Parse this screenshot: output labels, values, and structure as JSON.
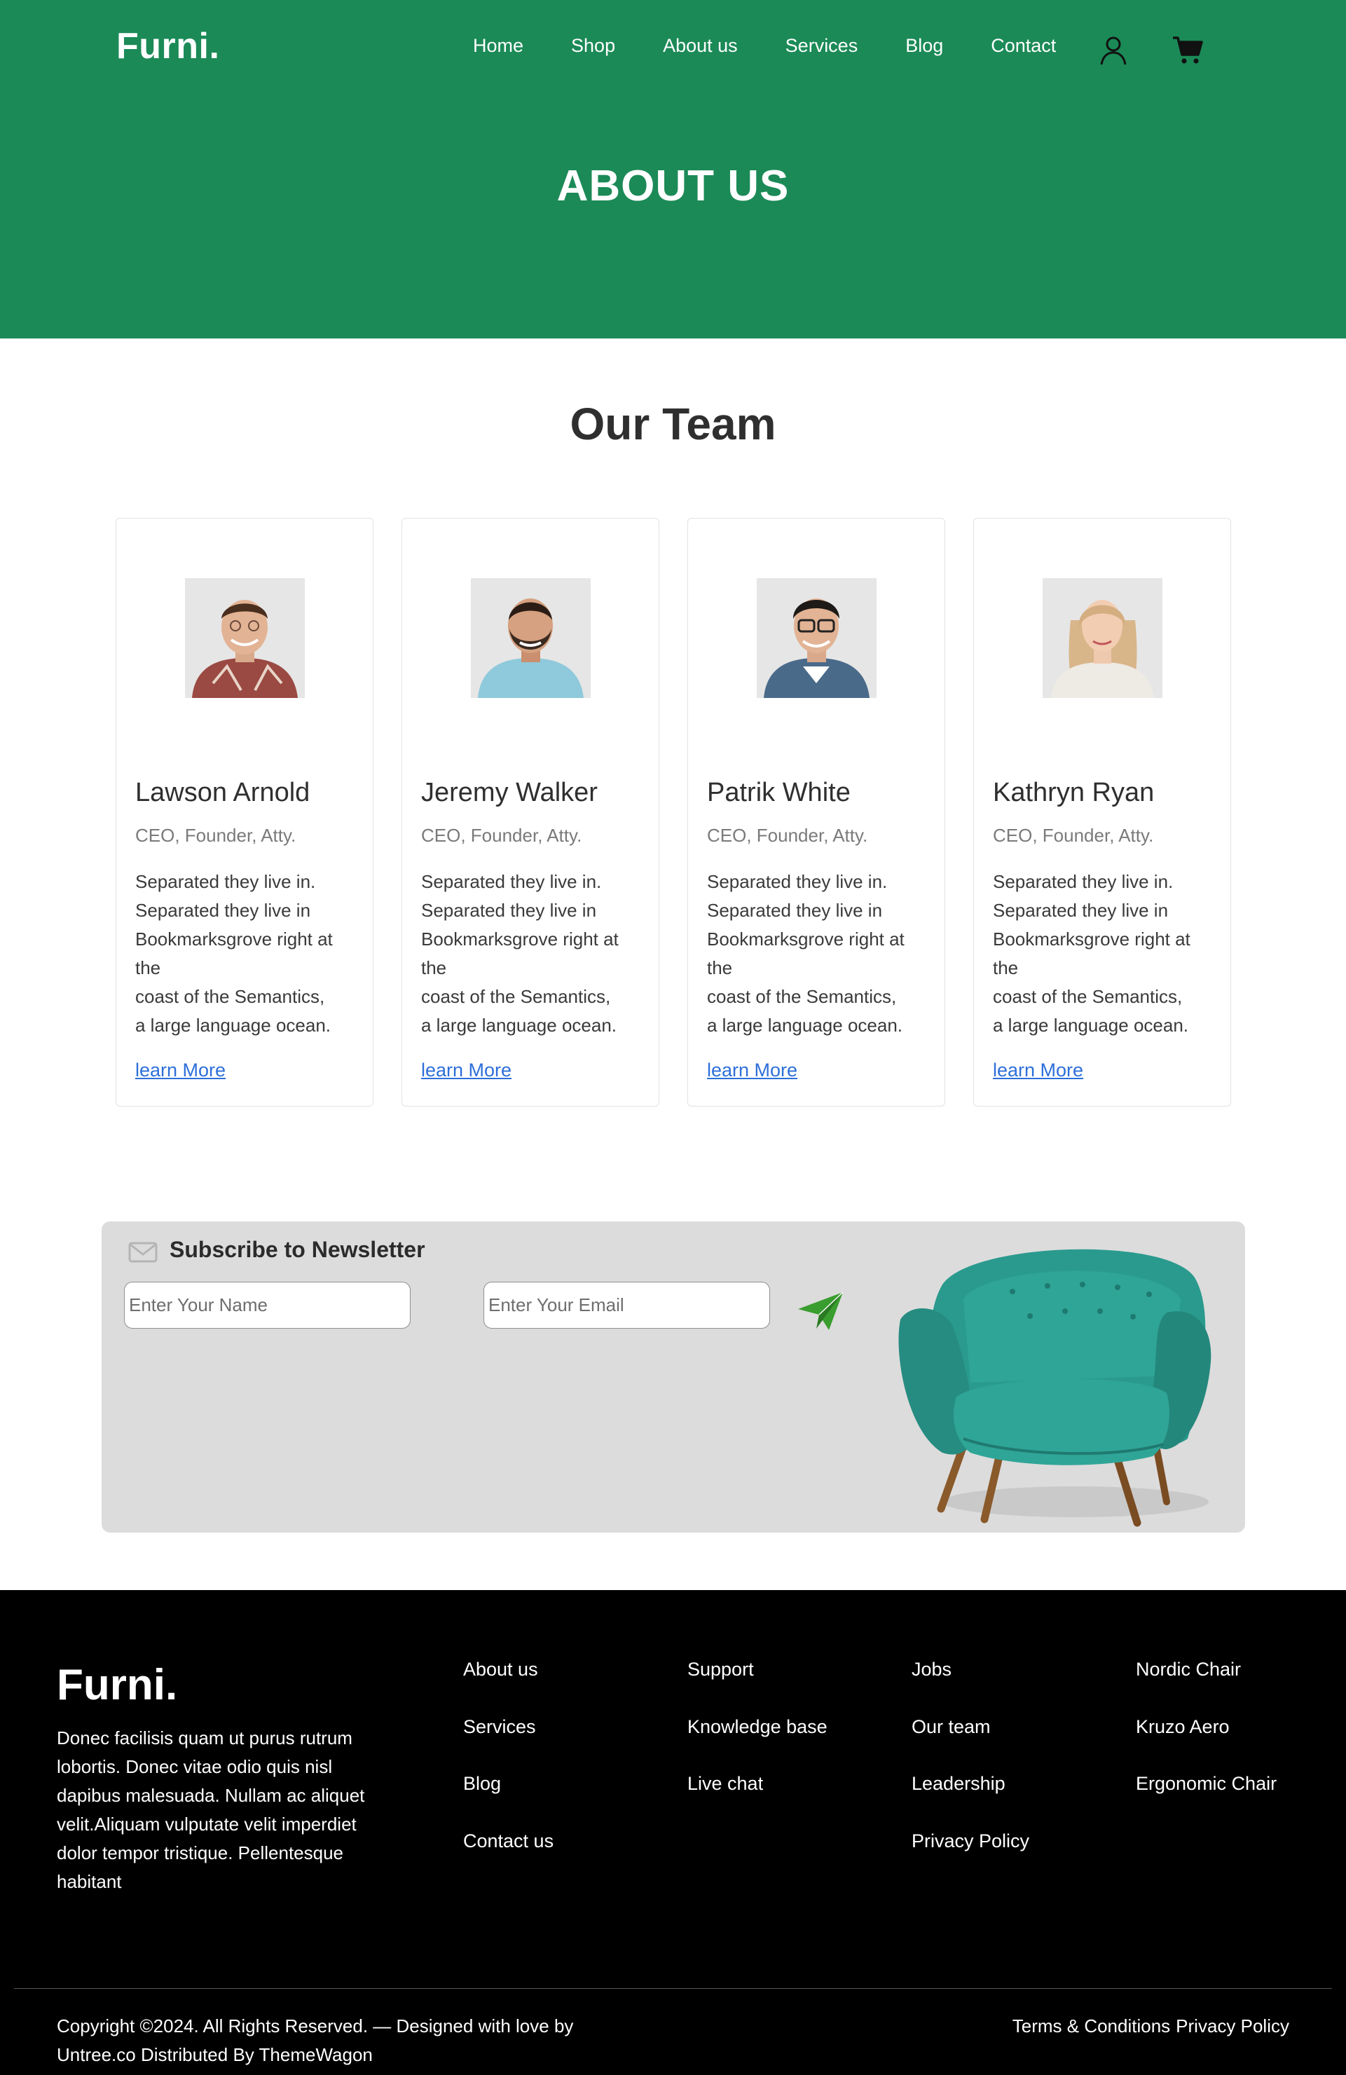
{
  "header": {
    "logo": "Furni.",
    "nav": [
      "Home",
      "Shop",
      "About us",
      "Services",
      "Blog",
      "Contact"
    ],
    "icons": [
      "user-icon",
      "cart-icon"
    ],
    "colors": {
      "primary": "#1b8a57",
      "text_on_primary": "#ffffff"
    }
  },
  "hero": {
    "title": "ABOUT US"
  },
  "team": {
    "heading": "Our Team",
    "members": [
      {
        "name": "Lawson Arnold",
        "role": "CEO, Founder, Atty.",
        "desc": [
          "Separated they live in.",
          "Separated they live in",
          "Bookmarksgrove right at",
          "the",
          "coast of the Semantics,",
          "a large language ocean."
        ],
        "link": "learn More"
      },
      {
        "name": "Jeremy Walker",
        "role": "CEO, Founder, Atty.",
        "desc": [
          "Separated they live in.",
          "Separated they live in",
          "Bookmarksgrove right at",
          "the",
          "coast of the Semantics,",
          "a large language ocean."
        ],
        "link": "learn More"
      },
      {
        "name": "Patrik White",
        "role": "CEO, Founder, Atty.",
        "desc": [
          "Separated they live in.",
          "Separated they live in",
          "Bookmarksgrove right at",
          "the",
          "coast of the Semantics,",
          "a large language ocean."
        ],
        "link": "learn More"
      },
      {
        "name": "Kathryn Ryan",
        "role": "CEO, Founder, Atty.",
        "desc": [
          "Separated they live in.",
          "Separated they live in",
          "Bookmarksgrove right at",
          "the",
          "coast of the Semantics,",
          "a large language ocean."
        ],
        "link": "learn More"
      }
    ],
    "link_color": "#2d6fd9"
  },
  "newsletter": {
    "title": "Subscribe to Newsletter",
    "name_placeholder": "Enter Your Name",
    "email_placeholder": "Enter Your Email",
    "icons": [
      "envelope-icon",
      "send-icon"
    ],
    "background": "#dcdcdc",
    "send_color": "#3a9d2f"
  },
  "footer": {
    "logo": "Furni.",
    "about": [
      "Donec facilisis quam ut purus rutrum",
      "lobortis. Donec vitae odio quis nisl",
      "dapibus malesuada. Nullam ac aliquet",
      "velit.Aliquam vulputate velit imperdiet",
      "dolor tempor tristique. Pellentesque",
      "habitant"
    ],
    "columns": [
      [
        "About us",
        "Services",
        "Blog",
        "Contact us"
      ],
      [
        "Support",
        "Knowledge base",
        "Live chat"
      ],
      [
        "Jobs",
        "Our team",
        "Leadership",
        "Privacy Policy"
      ],
      [
        "Nordic Chair",
        "Kruzo Aero",
        "Ergonomic Chair"
      ]
    ],
    "copyright": [
      "Copyright ©2024. All Rights Reserved. — Designed with love by",
      "Untree.co Distributed By ThemeWagon"
    ],
    "legal": [
      "Terms & Conditions",
      "Privacy Policy"
    ]
  }
}
